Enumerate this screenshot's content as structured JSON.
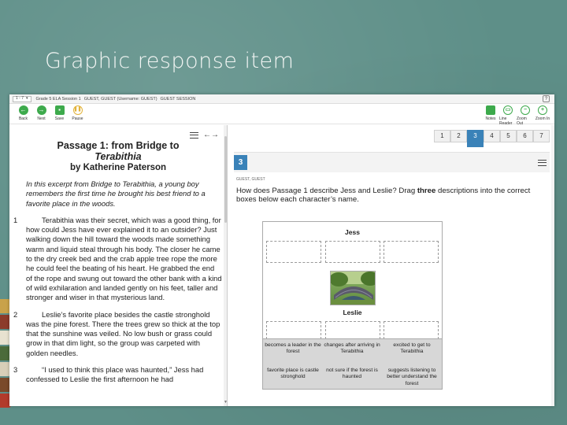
{
  "slide": {
    "title": "Graphic response item"
  },
  "infobar": {
    "question_select": "1 - 7",
    "test_name": "Grade 5 ELA Session 1",
    "user": "GUEST, GUEST (Username: GUEST)",
    "session": "GUEST SESSION",
    "help": "?"
  },
  "toolbar": {
    "left": [
      {
        "label": "Back",
        "icon": "back-arrow-icon",
        "glyph": "←"
      },
      {
        "label": "Next",
        "icon": "next-arrow-icon",
        "glyph": "→"
      },
      {
        "label": "Save",
        "icon": "save-icon",
        "glyph": "▪"
      },
      {
        "label": "Pause",
        "icon": "pause-icon",
        "glyph": "❚❚"
      }
    ],
    "right": [
      {
        "label": "Notes",
        "icon": "notes-icon",
        "glyph": "✎"
      },
      {
        "label": "Line Reader",
        "icon": "line-reader-icon",
        "glyph": "▭"
      },
      {
        "label": "Zoom Out",
        "icon": "zoom-out-icon",
        "glyph": "−"
      },
      {
        "label": "Zoom In",
        "icon": "zoom-in-icon",
        "glyph": "+"
      }
    ]
  },
  "passage": {
    "title_line1": "Passage 1: from Bridge to",
    "title_line2": "Terabithia",
    "author": "by Katherine Paterson",
    "intro": "In this excerpt from Bridge to Terabithia, a young boy remembers the first time he brought his best friend to a favorite place in the woods.",
    "paragraphs": [
      {
        "num": "1",
        "text": "Terabithia was their secret, which was a good thing, for how could Jess have ever explained it to an outsider? Just walking down the hill toward the woods made something warm and liquid steal through his body. The closer he came to the dry creek bed and the crab apple tree rope the more he could feel the beating of his heart. He grabbed the end of the rope and swung out toward the other bank with a kind of wild exhilaration and landed gently on his feet, taller and stronger and wiser in that mysterious land."
      },
      {
        "num": "2",
        "text": "Leslie’s favorite place besides the castle stronghold was the pine forest. There the trees grew so thick at the top that the sunshine was veiled. No low bush or grass could grow in that dim light, so the group was carpeted with golden needles."
      },
      {
        "num": "3",
        "text": "“I used to think this place was haunted,” Jess had confessed to Leslie the first afternoon he had"
      }
    ]
  },
  "question": {
    "tabs": [
      "1",
      "2",
      "3",
      "4",
      "5",
      "6",
      "7"
    ],
    "active_tab": "3",
    "number": "3",
    "guest_label": "GUEST, GUEST",
    "text_before": "How does Passage 1 describe Jess and Leslie? Drag ",
    "text_bold": "three",
    "text_after": " descriptions into the correct boxes below each character’s name.",
    "names": {
      "first": "Jess",
      "second": "Leslie"
    },
    "options": [
      "becomes a leader in the forest",
      "changes after arriving in Terabithia",
      "excited to get to Terabithia",
      "favorite place is castle stronghold",
      "not sure if the forest is haunted",
      "suggests listening to better understand the forest"
    ]
  }
}
